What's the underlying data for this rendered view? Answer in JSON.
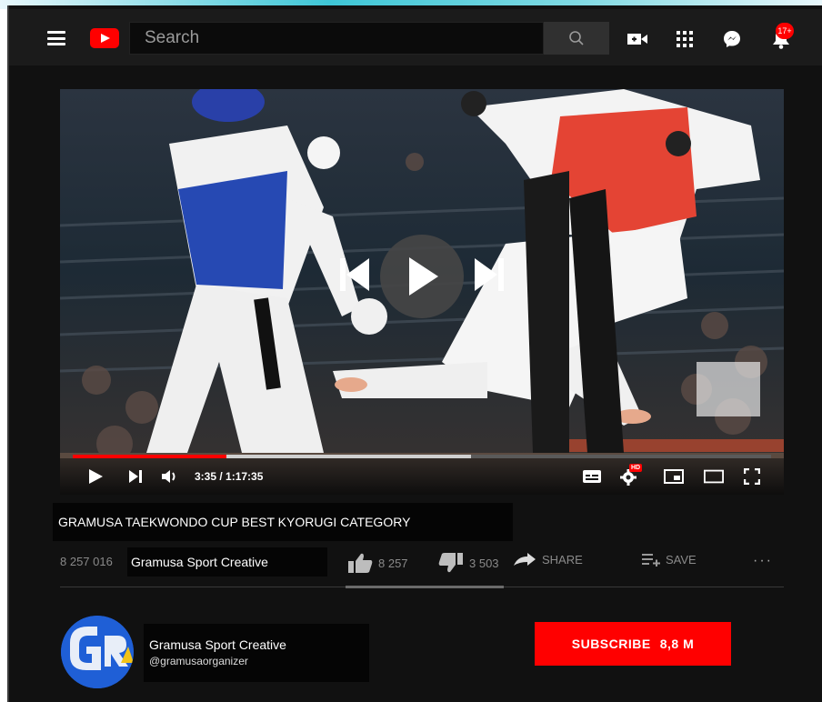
{
  "header": {
    "search": {
      "placeholder": "Search"
    },
    "notifications_badge": "17+"
  },
  "player": {
    "time_display": "3:35 / 1:17:35",
    "progress_played_fraction": 0.22,
    "progress_buffered_fraction": 0.57,
    "hd_badge": "HD"
  },
  "video": {
    "title": "GRAMUSA TAEKWONDO CUP BEST KYORUGI CATEGORY",
    "views": "8 257 016",
    "channel_chip": "Gramusa Sport Creative",
    "likes": "8 257",
    "dislikes": "3 503",
    "share_label": "SHARE",
    "save_label": "SAVE",
    "more": "···"
  },
  "channel": {
    "name": "Gramusa Sport Creative",
    "handle": "@gramusaorganizer",
    "subscribe_label": "SUBSCRIBE",
    "subscriber_count": "8,8 M"
  },
  "colors": {
    "accent": "#ff0000",
    "background": "#111111",
    "header": "#1b1b1b"
  }
}
